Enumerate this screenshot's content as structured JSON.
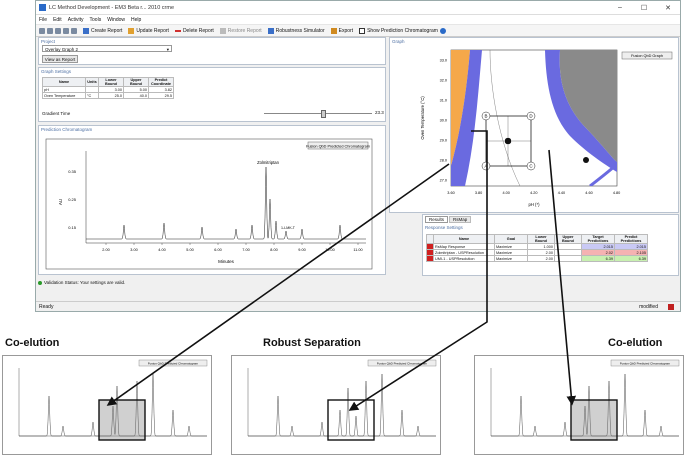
{
  "window": {
    "title": "LC Method Development - EM3 Beta r... 2010 crme",
    "controls": [
      "–",
      "☐",
      "✕"
    ]
  },
  "menu": [
    "File",
    "Edit",
    "Activity",
    "Tools",
    "Window",
    "Help"
  ],
  "toolbar": {
    "buttons": [
      {
        "label": "Create Report",
        "icon": "report-icon"
      },
      {
        "label": "Update Report",
        "icon": "update-icon"
      },
      {
        "label": "Delete Report",
        "icon": "delete-icon"
      },
      {
        "label": "Restore Report",
        "icon": "restore-icon"
      },
      {
        "label": "Robustness Simulator",
        "icon": "simulator-icon"
      },
      {
        "label": "Export",
        "icon": "export-icon"
      },
      {
        "label": "Show Prediction Chromatogram",
        "icon": "checkbox-icon"
      }
    ]
  },
  "project": {
    "label": "Project",
    "selection": "Overlay Graph 2",
    "view_button": "View as Report"
  },
  "graph_settings": {
    "label": "Graph Settings",
    "headers": [
      "Name",
      "Units",
      "Lower Bound",
      "Upper Bound",
      "Predict Coordinate"
    ],
    "rows": [
      [
        "pH",
        "",
        "3.00",
        "5.00",
        "3.82"
      ],
      [
        "Oven Temperature",
        "°C",
        "25.0",
        "40.0",
        "29.5"
      ]
    ],
    "gradient_label": "Gradient Time",
    "gradient_value": "23.3"
  },
  "prediction": {
    "label": "Prediction Chromatogram",
    "button": "Fusion QbD Predicted Chromatogram",
    "peak_label": "Zolmitriptan",
    "peak_label2": "1-LMK-T",
    "x_axis_label": "Minutes",
    "x_ticks": [
      "2.00",
      "3.00",
      "4.00",
      "5.00",
      "6.00",
      "7.00",
      "8.00",
      "9.00",
      "10.00",
      "11.00"
    ],
    "y_axis_label": "AU",
    "y_ticks": [
      "0.35",
      "0.25",
      "0.15"
    ]
  },
  "graph_panel": {
    "label": "Graph",
    "button": "Fusion QbD Graph",
    "y_axis_label": "Oven Temperature (°C)",
    "x_axis_label": "pH (*)",
    "y_ticks": [
      "33.0",
      "32.0",
      "31.0",
      "30.0",
      "29.0",
      "28.0",
      "27.0"
    ],
    "x_ticks": [
      "3.60",
      "3.80",
      "4.00",
      "4.20",
      "4.40",
      "4.60",
      "4.80"
    ],
    "corner_labels": [
      "A",
      "B",
      "C",
      "D"
    ]
  },
  "results": {
    "tabs": [
      "Results",
      "RsMap"
    ],
    "label": "Response Settings",
    "headers": [
      "Name",
      "Goal",
      "Lower Bound",
      "Upper Bound",
      "Target Predictions",
      "Predict Predictions"
    ],
    "rows": [
      [
        "RsMap Response",
        "Maximize",
        "1.000",
        "",
        "2.015",
        "2.015"
      ],
      [
        "Zolmitriptan - USPResolution",
        "Maximize",
        "2.00",
        "",
        "2.02",
        "2.105"
      ],
      [
        "UMI-1 - USPResolution",
        "Maximize",
        "2.00",
        "",
        "6.39",
        "6.39"
      ]
    ],
    "row_colors": [
      "#c9c9f5",
      "#f5b2b2",
      "#c8f0b0"
    ]
  },
  "validation": "Validation Status: Your settings are valid.",
  "status": {
    "left": "Ready",
    "right": "modified"
  },
  "headings": [
    "Co-elution",
    "Robust Separation",
    "Co-elution"
  ],
  "thumb_button": "Fusion QbD Predicted Chromatogram",
  "colors": {
    "blue_region": "#6a6ae0",
    "orange_region": "#f5a84a",
    "gray_region": "#8a8a8a",
    "accent": "#4d6fa3"
  }
}
